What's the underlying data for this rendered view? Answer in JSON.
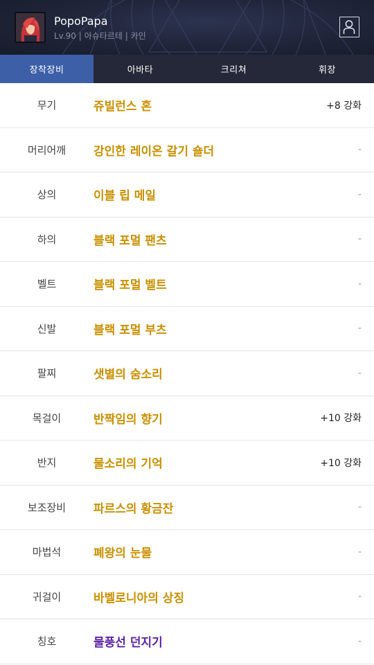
{
  "header": {
    "character_name": "PopoPapa",
    "level": "Lv.90",
    "server": "아슈타르테",
    "class": "카인",
    "separator": "|"
  },
  "tabs": [
    {
      "label": "장착장비",
      "active": true
    },
    {
      "label": "아바타",
      "active": false
    },
    {
      "label": "크리쳐",
      "active": false
    },
    {
      "label": "휘장",
      "active": false
    }
  ],
  "equipment": [
    {
      "slot": "무기",
      "item": "쥬빌런스 혼",
      "enhance": "+8 강화"
    },
    {
      "slot": "머리어깨",
      "item": "강인한 레이온 갈기 숄더",
      "enhance": "-"
    },
    {
      "slot": "상의",
      "item": "이블 립 메일",
      "enhance": "-"
    },
    {
      "slot": "하의",
      "item": "블랙 포멀 팬츠",
      "enhance": "-"
    },
    {
      "slot": "벨트",
      "item": "블랙 포멀 벨트",
      "enhance": "-"
    },
    {
      "slot": "신발",
      "item": "블랙 포멀 부츠",
      "enhance": "-"
    },
    {
      "slot": "팔찌",
      "item": "샛별의 숨소리",
      "enhance": "-"
    },
    {
      "slot": "목걸이",
      "item": "반짝임의 향기",
      "enhance": "+10 강화"
    },
    {
      "slot": "반지",
      "item": "물소리의 기억",
      "enhance": "+10 강화"
    },
    {
      "slot": "보조장비",
      "item": "파르스의 황금잔",
      "enhance": "-"
    },
    {
      "slot": "마법석",
      "item": "폐왕의 눈물",
      "enhance": "-"
    },
    {
      "slot": "귀걸이",
      "item": "바벨로니아의 상징",
      "enhance": "-"
    },
    {
      "slot": "칭호",
      "item": "물풍선 던지기",
      "enhance": "-"
    }
  ],
  "colors": {
    "unique_item": "#c99000",
    "rare_item": "#5c23a6",
    "active_tab": "#3c5fa8",
    "tab_bar": "#242838"
  },
  "icons": {
    "avatar": "character-portrait",
    "profile": "profile-person-icon"
  }
}
